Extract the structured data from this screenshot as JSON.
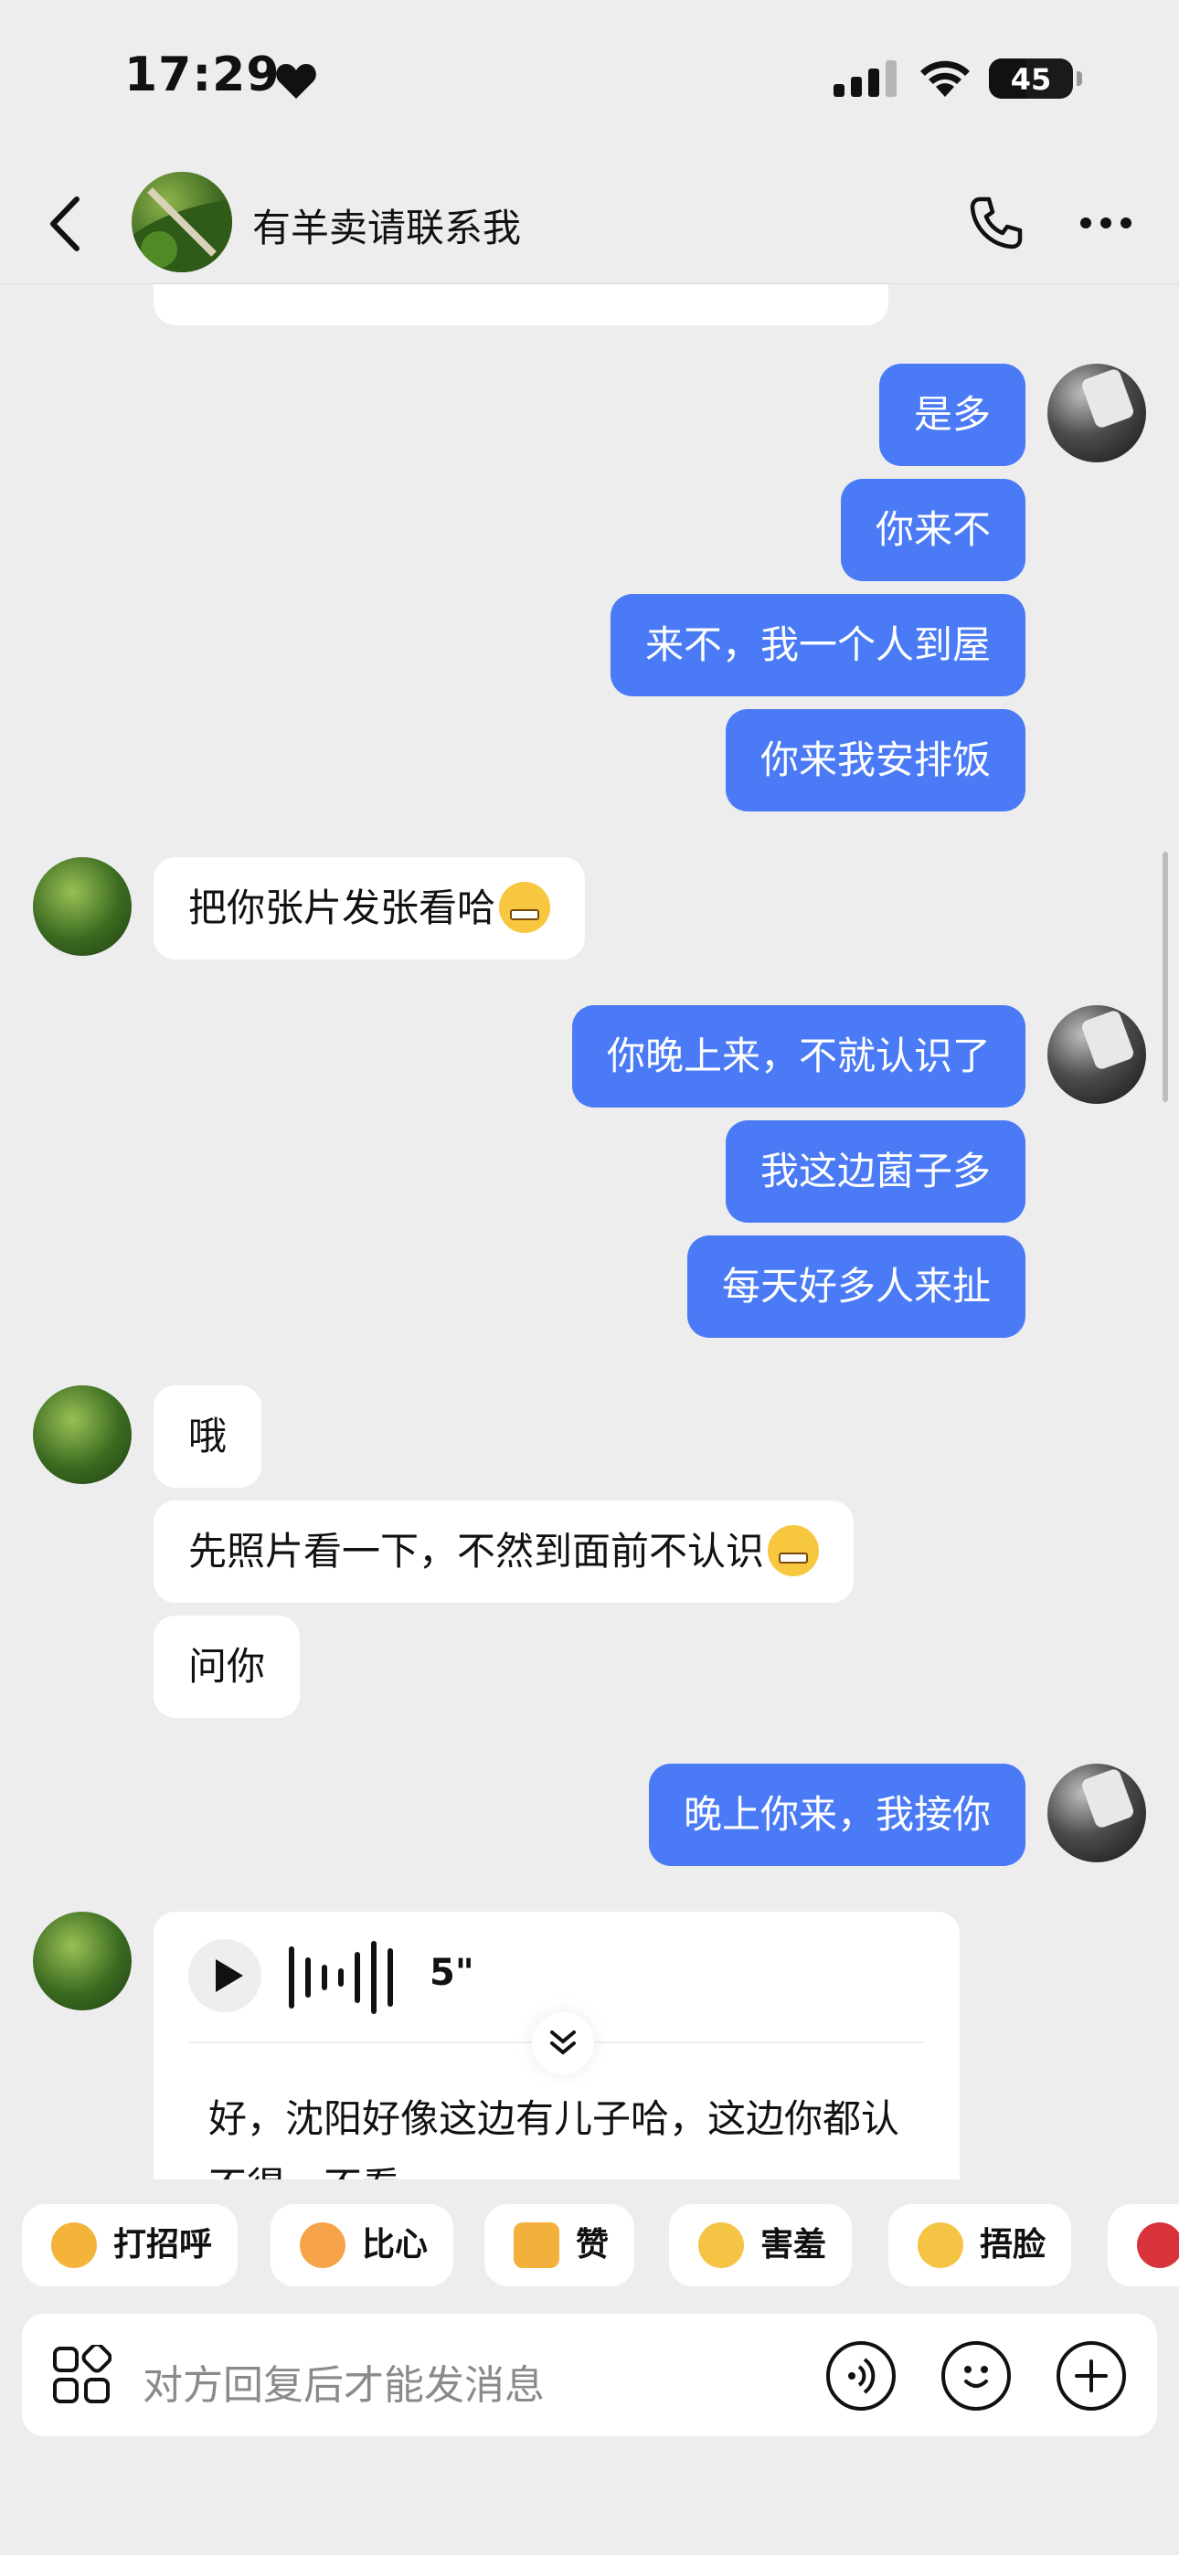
{
  "status_bar": {
    "time": "17:29",
    "battery": "45"
  },
  "header": {
    "title": "有羊卖请联系我"
  },
  "messages": {
    "m1": "是多",
    "m2": "你来不",
    "m3": "来不，我一个人到屋",
    "m4": "你来我安排饭",
    "m5": "把你张片发张看哈",
    "m6": "你晚上来，不就认识了",
    "m7": "我这边菌子多",
    "m8": "每天好多人来扯",
    "m9": "哦",
    "m10": "先照片看一下，不然到面前不认识",
    "m11": "问你",
    "m12": "晚上你来，我接你"
  },
  "voice": {
    "duration": "5\"",
    "transcript": "好，沈阳好像这边有儿子哈，这边你都认不得，不看"
  },
  "quick_replies": [
    {
      "label": "打招呼",
      "icon": "wave-hand-emoji-icon"
    },
    {
      "label": "比心",
      "icon": "finger-heart-emoji-icon"
    },
    {
      "label": "赞",
      "icon": "thumbs-up-emoji-icon"
    },
    {
      "label": "害羞",
      "icon": "shy-emoji-icon"
    },
    {
      "label": "捂脸",
      "icon": "facepalm-emoji-icon"
    },
    {
      "label": "",
      "icon": "rose-emoji-icon"
    }
  ],
  "input": {
    "placeholder": "对方回复后才能发消息"
  },
  "colors": {
    "outgoing_bubble": "#4A7AF5",
    "incoming_bubble": "#FFFFFF",
    "background": "#EDEDED"
  }
}
